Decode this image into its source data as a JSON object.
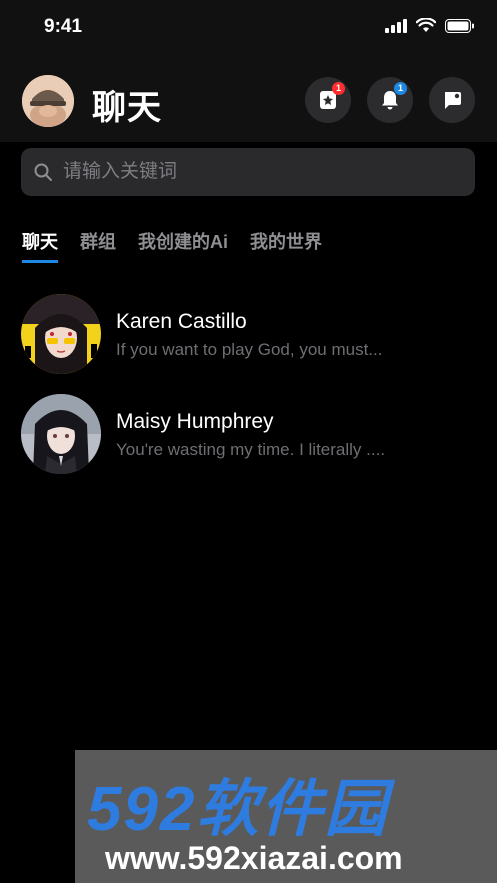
{
  "status_bar": {
    "time": "9:41"
  },
  "header": {
    "title": "聊天",
    "star_badge": "1",
    "notification_badge": "1"
  },
  "search": {
    "placeholder": "请输入关键词"
  },
  "tabs": [
    {
      "label": "聊天",
      "active": true
    },
    {
      "label": "群组",
      "active": false
    },
    {
      "label": "我创建的Ai",
      "active": false
    },
    {
      "label": "我的世界",
      "active": false
    }
  ],
  "chats": [
    {
      "name": "Karen Castillo",
      "preview": "If you want to play God, you must..."
    },
    {
      "name": "Maisy Humphrey",
      "preview": "You're wasting my time. I literally ...."
    }
  ],
  "watermark": {
    "brand": "592软件园",
    "url": "www.592xiazai.com"
  },
  "colors": {
    "accent": "#1e88e5",
    "badge_red": "#ff2d2d",
    "background": "#000000"
  }
}
